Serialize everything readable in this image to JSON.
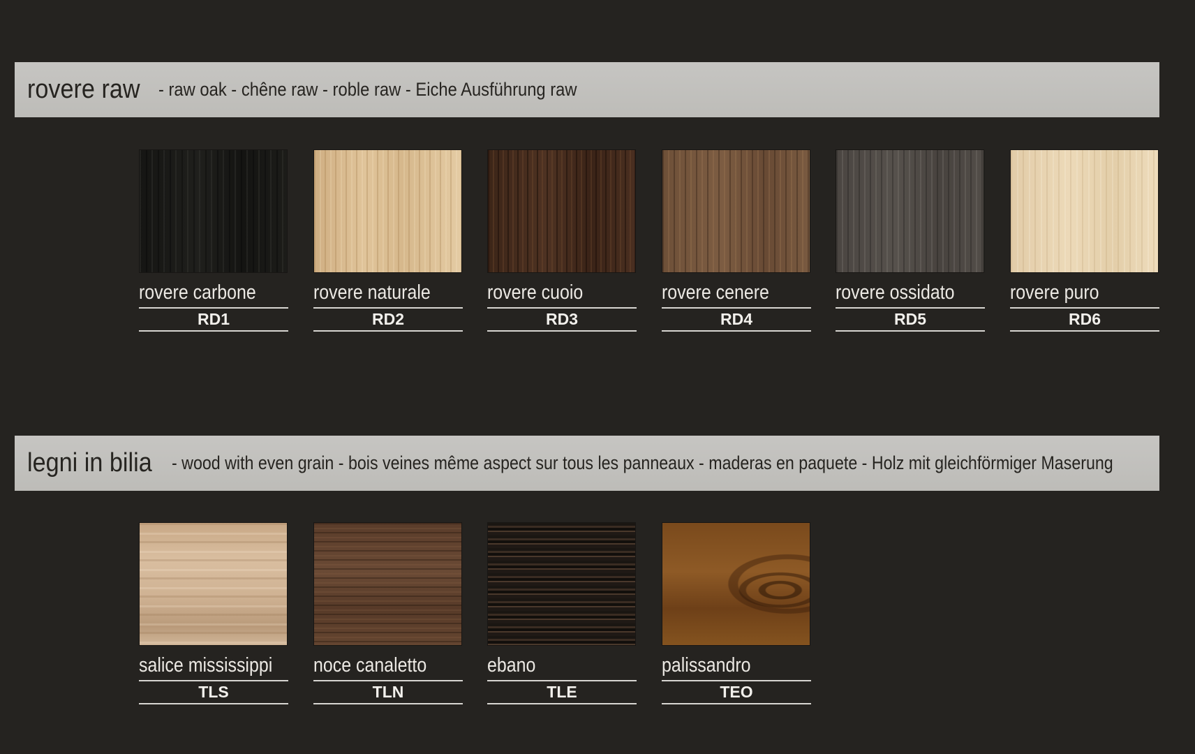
{
  "sections": [
    {
      "title": "rovere raw",
      "subtitle": "- raw oak - chêne raw - roble raw - Eiche Ausführung raw",
      "swatches": [
        {
          "name": "rovere carbone",
          "code": "RD1",
          "color": "#1a1a17"
        },
        {
          "name": "rovere naturale",
          "code": "RD2",
          "color": "#d9bb90"
        },
        {
          "name": "rovere cuoio",
          "code": "RD3",
          "color": "#452b1d"
        },
        {
          "name": "rovere cenere",
          "code": "RD4",
          "color": "#74563d"
        },
        {
          "name": "rovere ossidato",
          "code": "RD5",
          "color": "#4f4a45"
        },
        {
          "name": "rovere puro",
          "code": "RD6",
          "color": "#e8d4b1"
        }
      ]
    },
    {
      "title": "legni in bilia",
      "subtitle": "- wood with even grain - bois veines même aspect sur tous les panneaux - maderas en paquete - Holz mit gleichförmiger Maserung",
      "swatches": [
        {
          "name": "salice mississippi",
          "code": "TLS",
          "color": "#cfb293"
        },
        {
          "name": "noce canaletto",
          "code": "TLN",
          "color": "#5f4230"
        },
        {
          "name": "ebano",
          "code": "TLE",
          "color": "#221b16"
        },
        {
          "name": "palissandro",
          "code": "TEO",
          "color": "#824f20"
        }
      ]
    }
  ]
}
